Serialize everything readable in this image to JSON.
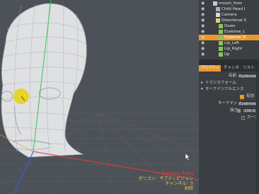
{
  "outliner": {
    "rows": [
      {
        "label": "morph_from",
        "icon": "group-icon",
        "selected": false
      },
      {
        "label": "Child Head I",
        "icon": "item-icon",
        "selected": false
      },
      {
        "label": "Camera",
        "icon": "camera-icon",
        "selected": false
      },
      {
        "label": "Directional S",
        "icon": "light-icon",
        "selected": false
      },
      {
        "label": "Down",
        "icon": "morph-icon",
        "selected": false
      },
      {
        "label": "Eyebrow_L",
        "icon": "morph-icon",
        "selected": false
      },
      {
        "label": "Eyebrow_R",
        "icon": "morph-icon",
        "selected": true
      },
      {
        "label": "Lip_Left",
        "icon": "morph-icon",
        "selected": false
      },
      {
        "label": "Lip_Right",
        "icon": "morph-icon",
        "selected": false
      },
      {
        "label": "Up",
        "icon": "morph-icon",
        "selected": false
      }
    ]
  },
  "tabs": [
    {
      "label": "プロパティ",
      "active": true
    },
    {
      "label": "チャンネ",
      "active": false
    },
    {
      "label": "リスト",
      "active": false
    }
  ],
  "properties": {
    "name_label": "名前",
    "name_value": "Eyebrow_R",
    "transform_label": "トランスフォーム",
    "morph_influence_label": "モーフインフルエンス",
    "enable_label": "有効",
    "morph_map_label": "モーフマップ",
    "morph_map_value": "Eyebrow_R",
    "strength_label": "強さ",
    "strength_value": "100.0 %",
    "curve_label": "カーカ"
  },
  "hud": {
    "selection_name": "Eyebrow_Right",
    "polygon_line": "ポリゴン：サブディビジョン",
    "channel_line": "チャンネル：0",
    "delete_line": "削除"
  },
  "colors": {
    "accent": "#e89a2a",
    "selection_text": "#e4453b",
    "hud_text": "#e2d14a",
    "viewport_bg": "#4d5258",
    "panel_bg": "#3b3e43"
  }
}
